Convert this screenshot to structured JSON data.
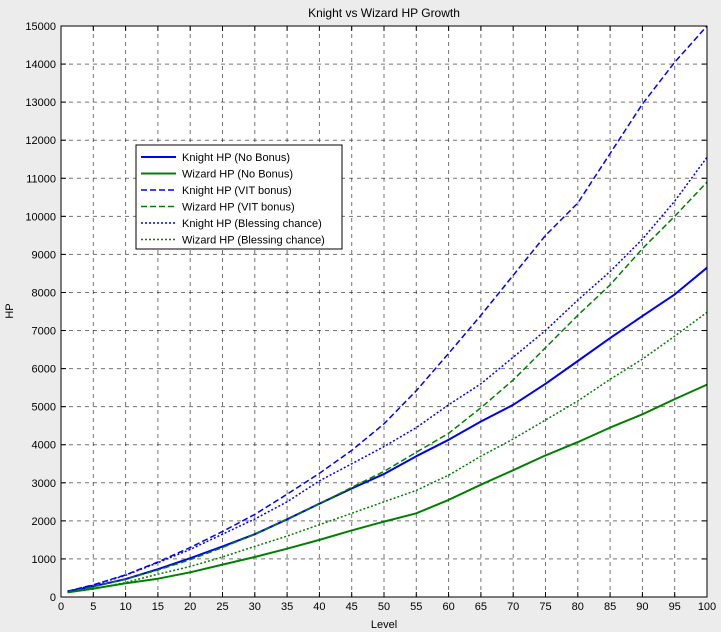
{
  "window": {
    "title": "Knight vs Wizard HP Growth"
  },
  "chart_data": {
    "type": "line",
    "title": "Knight vs Wizard HP Growth",
    "xlabel": "Level",
    "ylabel": "HP",
    "xlim": [
      0,
      100
    ],
    "ylim": [
      0,
      15000
    ],
    "xticks": [
      0,
      5,
      10,
      15,
      20,
      25,
      30,
      35,
      40,
      45,
      50,
      55,
      60,
      65,
      70,
      75,
      80,
      85,
      90,
      95,
      100
    ],
    "yticks": [
      0,
      1000,
      2000,
      3000,
      4000,
      5000,
      6000,
      7000,
      8000,
      9000,
      10000,
      11000,
      12000,
      13000,
      14000,
      15000
    ],
    "grid": true,
    "legend_position": "upper-left",
    "series": [
      {
        "name": "Knight HP (No Bonus)",
        "color": "#0000ff",
        "style": "solid",
        "x": [
          1,
          5,
          10,
          15,
          20,
          25,
          30,
          35,
          40,
          45,
          50,
          55,
          60,
          65,
          70,
          75,
          80,
          85,
          90,
          95,
          100
        ],
        "y": [
          150,
          280,
          470,
          730,
          1020,
          1330,
          1650,
          2040,
          2450,
          2850,
          3230,
          3700,
          4130,
          4610,
          5050,
          5600,
          6200,
          6800,
          7380,
          7950,
          8650
        ]
      },
      {
        "name": "Wizard HP (No Bonus)",
        "color": "#008000",
        "style": "solid",
        "x": [
          1,
          5,
          10,
          15,
          20,
          25,
          30,
          35,
          40,
          45,
          50,
          55,
          60,
          65,
          70,
          75,
          80,
          85,
          90,
          95,
          100
        ],
        "y": [
          120,
          220,
          360,
          480,
          650,
          850,
          1050,
          1270,
          1500,
          1750,
          1980,
          2200,
          2550,
          2950,
          3330,
          3720,
          4070,
          4450,
          4800,
          5200,
          5580
        ]
      },
      {
        "name": "Knight HP (VIT bonus)",
        "color": "#0000ff",
        "style": "dashed",
        "x": [
          1,
          5,
          10,
          15,
          20,
          25,
          30,
          35,
          40,
          45,
          50,
          55,
          60,
          65,
          70,
          75,
          80,
          85,
          90,
          95,
          100
        ],
        "y": [
          150,
          320,
          580,
          920,
          1300,
          1720,
          2170,
          2700,
          3250,
          3850,
          4550,
          5420,
          6400,
          7400,
          8450,
          9500,
          10350,
          11650,
          12950,
          14050,
          15000
        ]
      },
      {
        "name": "Wizard HP (VIT bonus)",
        "color": "#008000",
        "style": "dashed",
        "x": [
          1,
          5,
          10,
          15,
          20,
          25,
          30,
          35,
          40,
          45,
          50,
          55,
          60,
          65,
          70,
          75,
          80,
          85,
          90,
          95,
          100
        ],
        "y": [
          140,
          270,
          470,
          710,
          980,
          1300,
          1650,
          2050,
          2450,
          2880,
          3300,
          3800,
          4300,
          4970,
          5700,
          6550,
          7400,
          8200,
          9150,
          10000,
          10900
        ]
      },
      {
        "name": "Knight HP (Blessing chance)",
        "color": "#0000ff",
        "style": "dotted",
        "x": [
          1,
          5,
          10,
          15,
          20,
          25,
          30,
          35,
          40,
          45,
          50,
          55,
          60,
          65,
          70,
          75,
          80,
          85,
          90,
          95,
          100
        ],
        "y": [
          150,
          310,
          570,
          900,
          1250,
          1650,
          2050,
          2500,
          3050,
          3500,
          3950,
          4450,
          5050,
          5600,
          6300,
          7000,
          7800,
          8550,
          9400,
          10400,
          11550
        ]
      },
      {
        "name": "Wizard HP (Blessing chance)",
        "color": "#008000",
        "style": "dotted",
        "x": [
          1,
          5,
          10,
          15,
          20,
          25,
          30,
          35,
          40,
          45,
          50,
          55,
          60,
          65,
          70,
          75,
          80,
          85,
          90,
          95,
          100
        ],
        "y": [
          120,
          210,
          380,
          600,
          800,
          1050,
          1330,
          1600,
          1900,
          2200,
          2500,
          2800,
          3200,
          3700,
          4150,
          4650,
          5150,
          5720,
          6250,
          6850,
          7480
        ]
      }
    ]
  }
}
